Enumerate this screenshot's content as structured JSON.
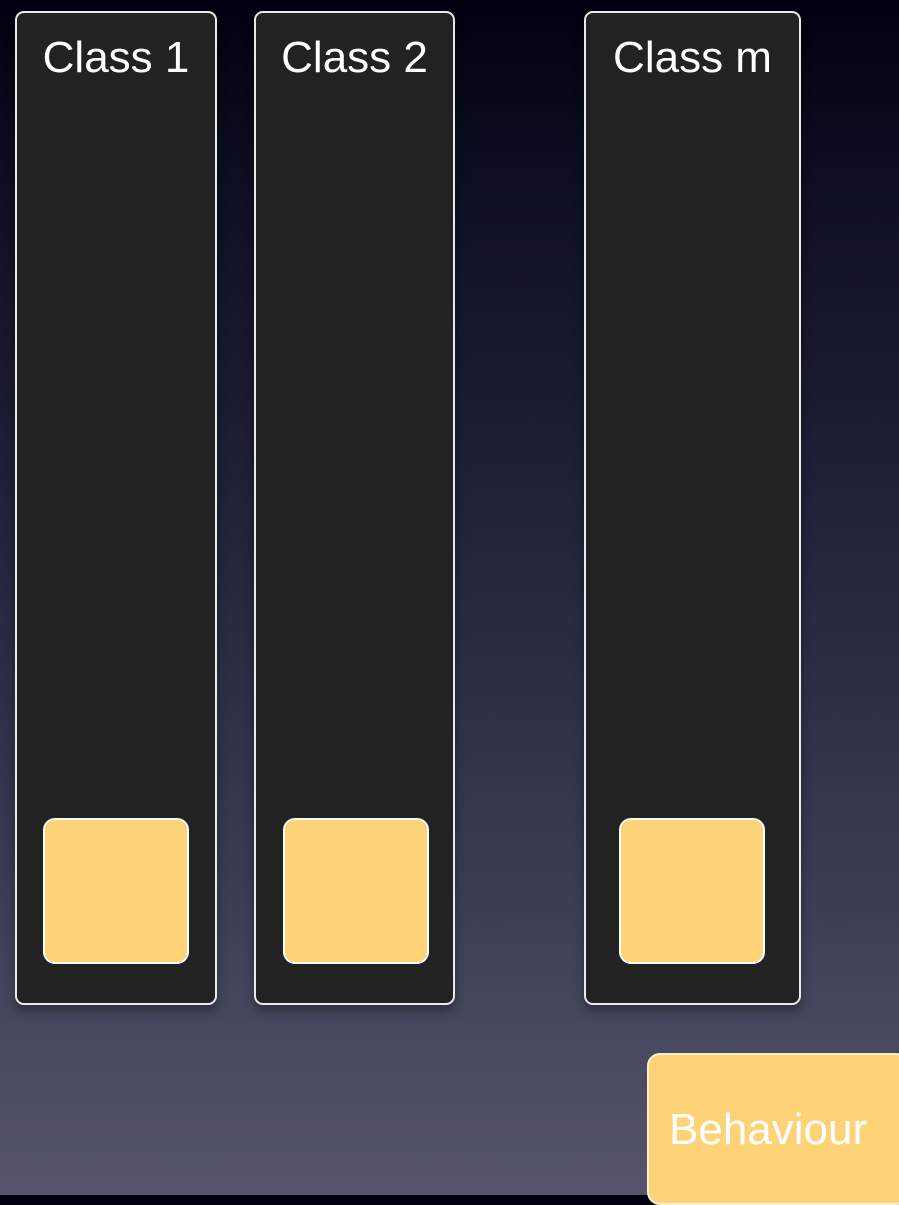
{
  "classes": [
    {
      "title": "Class 1"
    },
    {
      "title": "Class 2"
    },
    {
      "title": "Class m"
    }
  ],
  "behaviour": {
    "label": "Behaviour"
  },
  "colors": {
    "panel": "#222222",
    "panel_border": "#e9e9e9",
    "square": "#fed276",
    "text": "#ffffff"
  }
}
